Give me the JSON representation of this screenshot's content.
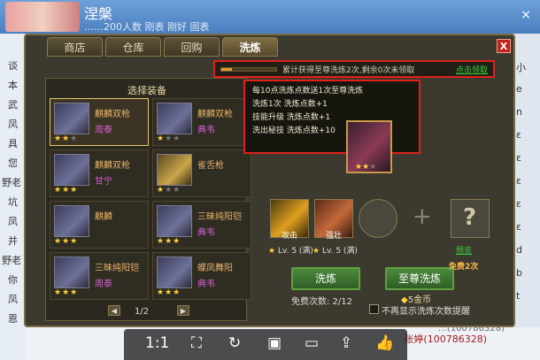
{
  "colors": {
    "accent_red": "#e0201a",
    "link_green": "#35d13a",
    "star": "#ffd23c",
    "owner_purple": "#d060d0"
  },
  "chat": {
    "title": "涅槃",
    "subtitle": "……200人数 刚表 刚好 固表",
    "close": "×",
    "left_glyphs": [
      "谈",
      "本",
      "武",
      "凤",
      "具",
      "您",
      "野老",
      "坑",
      "凤",
      "并",
      "野老",
      "你",
      "凤",
      "恩"
    ],
    "right_glyphs": [
      "小",
      "e",
      "n",
      "ε",
      "ε",
      "ε",
      "ε",
      "ε",
      "d",
      "b",
      "t"
    ],
    "bottom_text": "张婷(100786328)",
    "bottom_text2": "…(100786328)"
  },
  "viewer": {
    "ratio": "1:1",
    "icons": [
      "fit-icon",
      "rotate-icon",
      "save-icon",
      "monitor-icon",
      "share-icon",
      "like-icon"
    ]
  },
  "game": {
    "tabs": [
      "商店",
      "仓库",
      "回购",
      "洗炼"
    ],
    "active_tab": 3,
    "close_label": "X",
    "select_title": "选择装备",
    "items": [
      {
        "name": "麒麟双枪",
        "owner": "周泰",
        "stars": 2,
        "selected": true,
        "icon": "spear-icon"
      },
      {
        "name": "麒麟双枪",
        "owner": "典韦",
        "stars": 1,
        "selected": false,
        "icon": "spear-icon"
      },
      {
        "name": "麒麟双枪",
        "owner": "甘宁",
        "stars": 3,
        "selected": false,
        "icon": "spear-icon"
      },
      {
        "name": "雀舌枪",
        "owner": "",
        "stars": 1,
        "selected": false,
        "icon": "blade-icon"
      },
      {
        "name": "麒麟",
        "owner": "",
        "stars": 3,
        "selected": false,
        "icon": "armor-icon"
      },
      {
        "name": "三昧纯阳铠",
        "owner": "典韦",
        "stars": 3,
        "selected": false,
        "icon": "armor-icon"
      },
      {
        "name": "三昧纯阳铠",
        "owner": "周泰",
        "stars": 3,
        "selected": false,
        "icon": "armor-icon"
      },
      {
        "name": "蝶凤舞阳",
        "owner": "典韦",
        "stars": 3,
        "selected": false,
        "icon": "armor-icon"
      }
    ],
    "pager": "1/2",
    "progress": {
      "text": "累计获得至尊洗炼2次,剩余0次未领取",
      "link": "点击领取",
      "fraction": 0.2
    },
    "tooltip": [
      "每10点洗炼点数送1次至尊洗炼",
      "洗炼1次  洗炼点数+1",
      "技能升级  洗炼点数+1",
      "洗出秘技  洗炼点数+10"
    ],
    "skills": [
      {
        "label": "攻击",
        "level": "Lv. 5 (满)"
      },
      {
        "label": "强壮",
        "level": "Lv. 5 (满)"
      }
    ],
    "star_glyph": "★",
    "plus": "+",
    "question": "?",
    "preview_link": "预览",
    "wash_button": "洗炼",
    "supreme_button": "至尊洗炼",
    "free_badge": "免费2次",
    "free_count": "免费次数: 2/12",
    "cost": "5金币",
    "no_show_label": "不再显示洗炼次数提醒"
  }
}
